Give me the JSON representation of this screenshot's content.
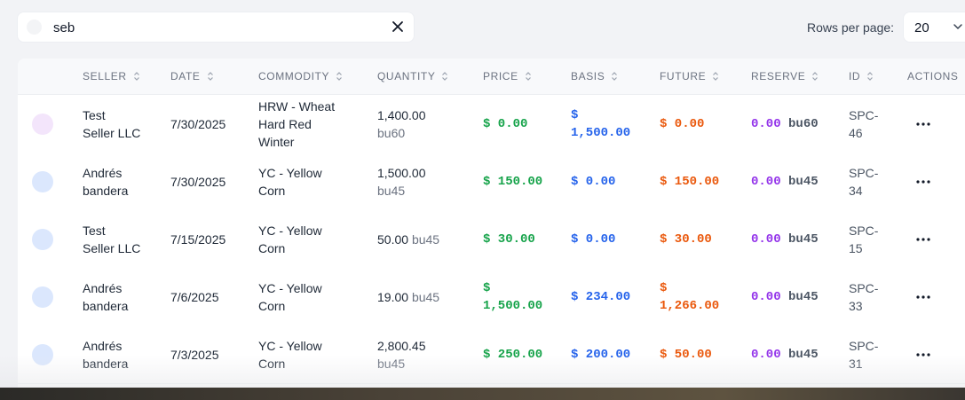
{
  "search": {
    "value": "seb"
  },
  "rows_per_page": {
    "label": "Rows per page:",
    "value": "20"
  },
  "columns": [
    "SELLER",
    "DATE",
    "COMMODITY",
    "QUANTITY",
    "PRICE",
    "BASIS",
    "FUTURE",
    "RESERVE",
    "ID",
    "ACTIONS"
  ],
  "rows": [
    {
      "seller": [
        "Test",
        "Seller LLC"
      ],
      "date": "7/30/2025",
      "commodity": [
        "HRW - Wheat",
        "Hard Red",
        "Winter"
      ],
      "qty": "1,400.00",
      "qty_unit": "bu60",
      "price": [
        "$ 0.00"
      ],
      "basis": [
        "$",
        "1,500.00"
      ],
      "future": [
        "$ 0.00"
      ],
      "reserve": "0.00",
      "reserve_unit": "bu60",
      "id": [
        "SPC-",
        "46"
      ]
    },
    {
      "seller": [
        "Andrés",
        "bandera"
      ],
      "date": "7/30/2025",
      "commodity": [
        "YC - Yellow",
        "Corn"
      ],
      "qty": "1,500.00",
      "qty_unit": "bu45",
      "price": [
        "$ 150.00"
      ],
      "basis": [
        "$ 0.00"
      ],
      "future": [
        "$ 150.00"
      ],
      "reserve": "0.00",
      "reserve_unit": "bu45",
      "id": [
        "SPC-",
        "34"
      ]
    },
    {
      "seller": [
        "Test",
        "Seller LLC"
      ],
      "date": "7/15/2025",
      "commodity": [
        "YC - Yellow",
        "Corn"
      ],
      "qty": "50.00",
      "qty_unit": "bu45",
      "price": [
        "$ 30.00"
      ],
      "basis": [
        "$ 0.00"
      ],
      "future": [
        "$ 30.00"
      ],
      "reserve": "0.00",
      "reserve_unit": "bu45",
      "id": [
        "SPC-",
        "15"
      ]
    },
    {
      "seller": [
        "Andrés",
        "bandera"
      ],
      "date": "7/6/2025",
      "commodity": [
        "YC - Yellow",
        "Corn"
      ],
      "qty": "19.00",
      "qty_unit": "bu45",
      "price": [
        "$",
        "1,500.00"
      ],
      "basis": [
        "$ 234.00"
      ],
      "future": [
        "$",
        "1,266.00"
      ],
      "reserve": "0.00",
      "reserve_unit": "bu45",
      "id": [
        "SPC-",
        "33"
      ]
    },
    {
      "seller": [
        "Andrés",
        "bandera"
      ],
      "date": "7/3/2025",
      "commodity": [
        "YC - Yellow",
        "Corn"
      ],
      "qty": "2,800.45",
      "qty_unit": "bu45",
      "price": [
        "$ 250.00"
      ],
      "basis": [
        "$ 200.00"
      ],
      "future": [
        "$ 50.00"
      ],
      "reserve": "0.00",
      "reserve_unit": "bu45",
      "id": [
        "SPC-",
        "31"
      ]
    }
  ]
}
